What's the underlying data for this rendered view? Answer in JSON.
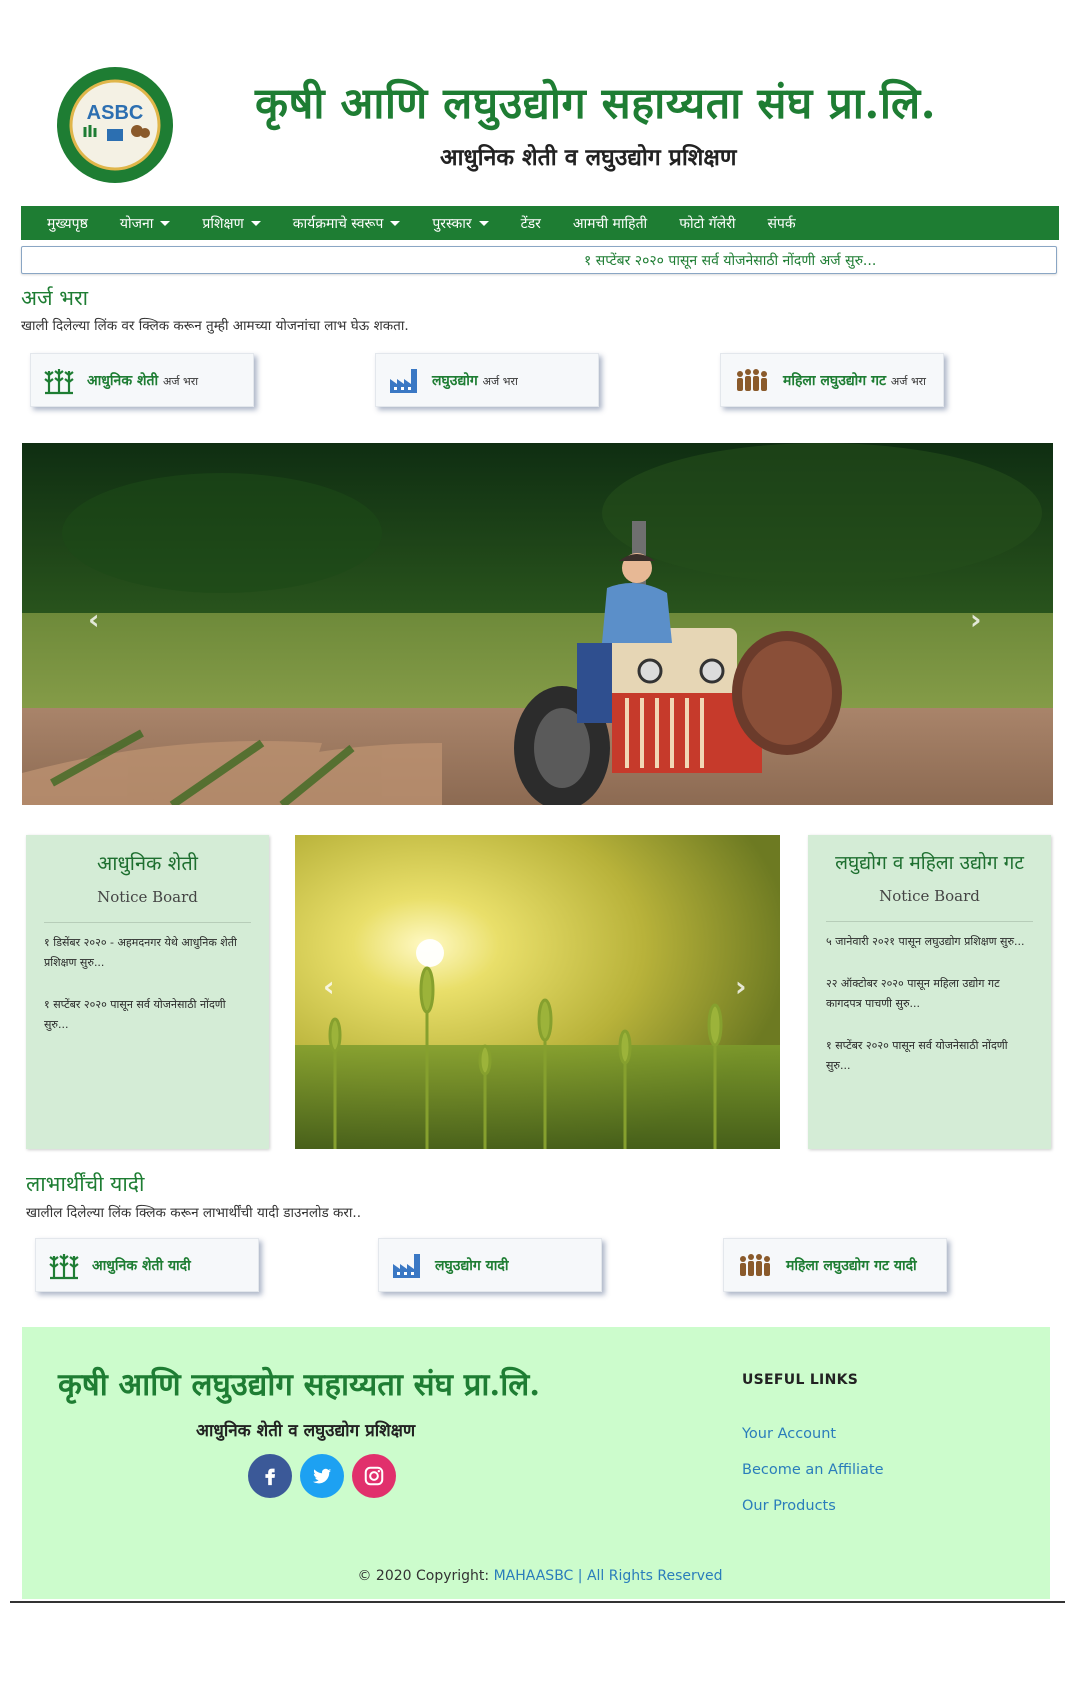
{
  "header": {
    "logo_text": "ASBC",
    "title": "कृषी आणि लघुउद्योग सहाय्यता संघ प्रा.लि.",
    "subtitle": "आधुनिक शेती व लघुउद्योग प्रशिक्षण"
  },
  "nav": {
    "items": [
      {
        "label": "मुख्यपृष्ठ",
        "dropdown": false
      },
      {
        "label": "योजना",
        "dropdown": true
      },
      {
        "label": "प्रशिक्षण",
        "dropdown": true
      },
      {
        "label": "कार्यक्रमाचे स्वरूप",
        "dropdown": true
      },
      {
        "label": "पुरस्कार",
        "dropdown": true
      },
      {
        "label": "टेंडर",
        "dropdown": false
      },
      {
        "label": "आमची माहिती",
        "dropdown": false
      },
      {
        "label": "फोटो गॅलेरी",
        "dropdown": false
      },
      {
        "label": "संपर्क",
        "dropdown": false
      }
    ]
  },
  "ticker": {
    "text": "१ सप्टेंबर २०२० पासून सर्व योजनेसाठी नोंदणी अर्ज सुरु..."
  },
  "apply": {
    "heading": "अर्ज भरा",
    "description": "खाली दिलेल्या लिंक वर क्लिक करून तुम्ही आमच्या योजनांचा लाभ घेऊ शकता.",
    "buttons": [
      {
        "label": "आधुनिक शेती",
        "suffix": "अर्ज भरा",
        "icon": "crops-icon"
      },
      {
        "label": "लघुउद्योग",
        "suffix": "अर्ज भरा",
        "icon": "factory-icon"
      },
      {
        "label": "महिला लघुउद्योग गट",
        "suffix": "अर्ज भरा",
        "icon": "group-icon"
      }
    ]
  },
  "notice_left": {
    "title": "आधुनिक शेती",
    "subtitle": "Notice Board",
    "items": [
      "१ डिसेंबर २०२० - अहमदनगर येथे आधुनिक शेती प्रशिक्षण सुरु...",
      "१ सप्टेंबर २०२० पासून सर्व योजनेसाठी नोंदणी सुरु..."
    ]
  },
  "notice_right": {
    "title": "लघुद्योग व महिला उद्योग गट",
    "subtitle": "Notice Board",
    "items": [
      "५ जानेवारी २०२१ पासून लघुउद्योग प्रशिक्षण सुरु...",
      "२२ ऑक्टोबर २०२० पासून महिला उद्योग गट कागदपत्र पाचणी सुरु...",
      "१ सप्टेंबर २०२० पासून सर्व योजनेसाठी नोंदणी सुरु..."
    ]
  },
  "beneficiaries": {
    "heading": "लाभार्थींची यादी",
    "description": "खालील दिलेल्या लिंक क्लिक करून लाभार्थींची यादी डाउनलोड करा..",
    "buttons": [
      {
        "label": "आधुनिक शेती यादी",
        "icon": "crops-icon"
      },
      {
        "label": "लघुउद्योग यादी",
        "icon": "factory-icon"
      },
      {
        "label": "महिला लघुउद्योग गट यादी",
        "icon": "group-icon"
      }
    ]
  },
  "footer": {
    "title": "कृषी आणि लघुउद्योग सहाय्यता संघ प्रा.लि.",
    "subtitle": "आधुनिक शेती व लघुउद्योग प्रशिक्षण",
    "social": [
      {
        "name": "facebook-icon",
        "color": "#3b5998"
      },
      {
        "name": "twitter-icon",
        "color": "#1da1f2"
      },
      {
        "name": "instagram-icon",
        "color": "#e1306c"
      }
    ],
    "useful_links_heading": "USEFUL LINKS",
    "useful_links": [
      "Your Account",
      "Become an Affiliate",
      "Our Products"
    ],
    "copyright_prefix": "© 2020 Copyright: ",
    "copyright_link": "MAHAASBC | All Rights Reserved"
  },
  "colors": {
    "brand_green": "#1e7d33",
    "panel_green": "#d4ecd6",
    "footer_green": "#ccfccc",
    "link_blue": "#2a7dbb"
  }
}
